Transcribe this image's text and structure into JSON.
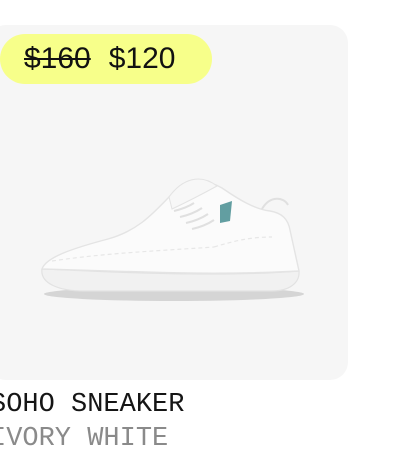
{
  "product": {
    "price_original": "$160",
    "price_current": "$120",
    "name": "SOHO SNEAKER",
    "color": "IVORY WHITE",
    "image_icon": "sneaker-icon"
  },
  "colors": {
    "card_background": "#f6f6f6",
    "price_pill": "#f7ff8a",
    "title_text": "#151515",
    "subtitle_text": "#8a8a8a"
  }
}
